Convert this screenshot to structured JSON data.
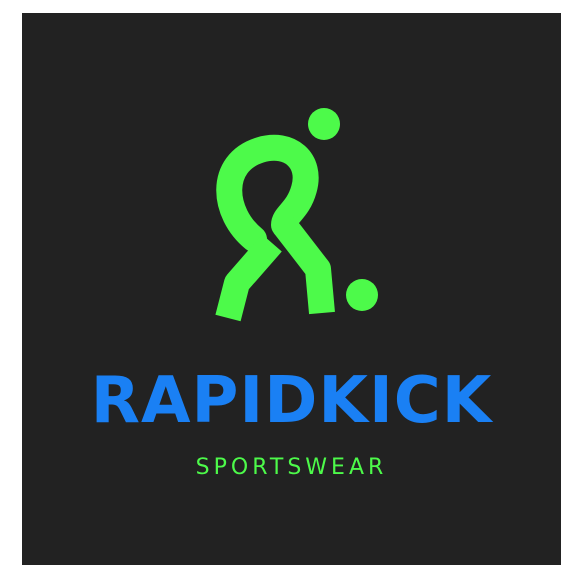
{
  "brand": {
    "name": "RAPIDKICK",
    "tagline": "SPORTSWEAR"
  },
  "logo": {
    "icon": "soccer-player-kicking-ball-icon"
  },
  "colors": {
    "background": "#222222",
    "page": "#ffffff",
    "primary_green": "#4dfa4a",
    "brand_blue": "#1a80f4",
    "tagline_green": "#4dfa4a"
  }
}
